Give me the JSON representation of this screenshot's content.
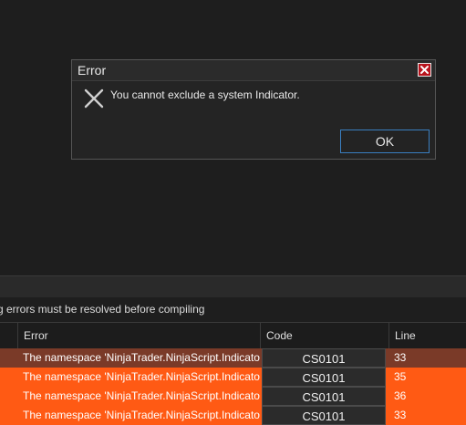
{
  "dialog": {
    "title": "Error",
    "message": "You cannot exclude a system Indicator.",
    "ok_label": "OK",
    "close_icon": "close-icon",
    "error_icon": "x-error-icon"
  },
  "status": {
    "text": "g errors must be resolved before compiling"
  },
  "grid": {
    "columns": {
      "error": "Error",
      "code": "Code",
      "line": "Line"
    },
    "rows": [
      {
        "error": "The namespace 'NinjaTrader.NinjaScript.Indicators'",
        "code": "CS0101",
        "line": "33",
        "color": "#7a3a28"
      },
      {
        "error": "The namespace 'NinjaTrader.NinjaScript.Indicators'",
        "code": "CS0101",
        "line": "35",
        "color": "#ff5a14"
      },
      {
        "error": "The namespace 'NinjaTrader.NinjaScript.Indicators'",
        "code": "CS0101",
        "line": "36",
        "color": "#ff5a14"
      },
      {
        "error": "The namespace 'NinjaTrader.NinjaScript.Indicators'",
        "code": "CS0101",
        "line": "33",
        "color": "#ff5a14"
      }
    ]
  }
}
